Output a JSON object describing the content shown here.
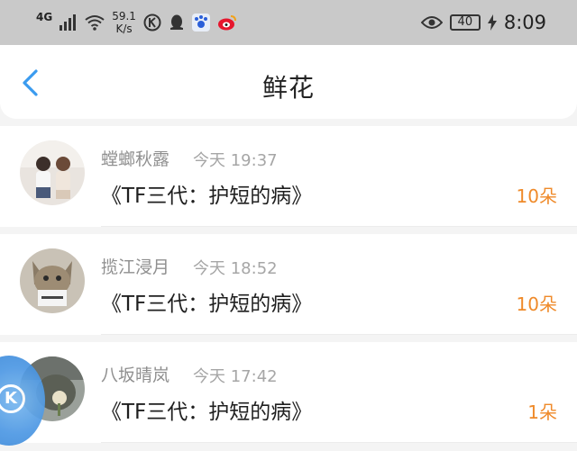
{
  "status_bar": {
    "network": "4G",
    "speed_value": "59.1",
    "speed_unit": "K/s",
    "battery": "40",
    "time": "8:09"
  },
  "header": {
    "title": "鲜花"
  },
  "items": [
    {
      "name": "螳螂秋露",
      "date": "今天 19:37",
      "book": "《TF三代：护短的病》",
      "count": "10朵"
    },
    {
      "name": "揽江浸月",
      "date": "今天 18:52",
      "book": "《TF三代：护短的病》",
      "count": "10朵"
    },
    {
      "name": "八坂晴岚",
      "date": "今天 17:42",
      "book": "《TF三代：护短的病》",
      "count": "1朵"
    }
  ],
  "colors": {
    "accent": "#3a9bef",
    "count": "#ef8a2a"
  }
}
